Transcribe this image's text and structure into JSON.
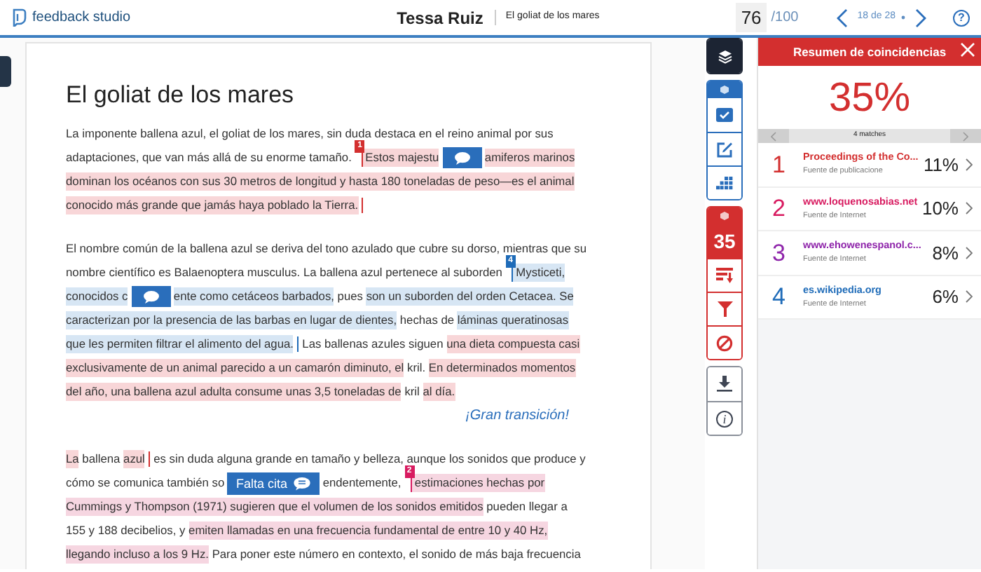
{
  "header": {
    "product": "feedback studio",
    "student": "Tessa Ruiz",
    "paper_title": "El goliat de los mares",
    "grade": "76",
    "grade_max": "/100",
    "pager": "18 de 28",
    "help_label": "?"
  },
  "document": {
    "title": "El goliat de los mares",
    "blocks": [
      {
        "kind": "paragraph",
        "lines": [
          {
            "parts": [
              {
                "kind": "text",
                "text": "La imponente ballena azul, el goliat de los mares, sin duda destaca en el reino animal por sus"
              }
            ]
          },
          {
            "parts": [
              {
                "kind": "text",
                "text": "adaptaciones, que van más allá de su enorme tamaño."
              },
              {
                "kind": "marker",
                "label": "1",
                "color": "#d32f2f"
              },
              {
                "kind": "text",
                "text": "Estos majestu",
                "color": "#f8d6d8"
              },
              {
                "kind": "bubble"
              },
              {
                "kind": "text",
                "text": "amiferos marinos",
                "color": "#f8d6d8"
              }
            ]
          },
          {
            "parts": [
              {
                "kind": "text",
                "text": "dominan los océanos con sus 30 metros de longitud y hasta 180 toneladas de peso—es el animal",
                "color": "#f8d6d8"
              }
            ]
          },
          {
            "parts": [
              {
                "kind": "text",
                "text": "conocido más grande que jamás haya poblado la Tierra.",
                "color": "#f8d6d8"
              },
              {
                "kind": "end",
                "color": "#d32f2f"
              }
            ]
          }
        ]
      },
      {
        "kind": "paragraph",
        "lines": [
          {
            "parts": [
              {
                "kind": "text",
                "text": "El nombre común de la ballena azul se deriva del tono azulado que cubre su dorso, mientras que su"
              }
            ]
          },
          {
            "parts": [
              {
                "kind": "text",
                "text": "nombre científico es Balaenoptera musculus. La ballena azul pertenece al suborden"
              },
              {
                "kind": "marker",
                "label": "4",
                "color": "#1e6bb8"
              },
              {
                "kind": "text",
                "text": "Mysticeti,",
                "color": "#d7e6f4"
              }
            ]
          },
          {
            "parts": [
              {
                "kind": "text",
                "text": "conocidos c",
                "color": "#d7e6f4"
              },
              {
                "kind": "bubble"
              },
              {
                "kind": "text",
                "text": "ente como cetáceos barbados,",
                "color": "#d7e6f4"
              },
              {
                "kind": "text",
                "text": "pues"
              },
              {
                "kind": "text",
                "text": "son un suborden del orden Cetacea. Se",
                "color": "#d7e6f4"
              }
            ]
          },
          {
            "parts": [
              {
                "kind": "text",
                "text": "caracterizan por la presencia de las barbas en lugar de dientes,",
                "color": "#d7e6f4"
              },
              {
                "kind": "text",
                "text": "hechas de"
              },
              {
                "kind": "text",
                "text": "láminas queratinosas",
                "color": "#d7e6f4"
              }
            ]
          },
          {
            "parts": [
              {
                "kind": "text",
                "text": "que les permiten filtrar el alimento del agua.",
                "color": "#d7e6f4"
              },
              {
                "kind": "end",
                "color": "#1e6bb8"
              },
              {
                "kind": "text",
                "text": "Las ballenas azules siguen"
              },
              {
                "kind": "text",
                "text": "una dieta compuesta casi",
                "color": "#f8d6d8"
              }
            ]
          },
          {
            "parts": [
              {
                "kind": "text",
                "text": "exclusivamente de un animal parecido a un camarón diminuto, el",
                "color": "#f8d6d8"
              },
              {
                "kind": "text",
                "text": "kril."
              },
              {
                "kind": "text",
                "text": "En determinados momentos",
                "color": "#f8d6d8"
              }
            ]
          },
          {
            "parts": [
              {
                "kind": "text",
                "text": "del año, una ballena azul adulta consume unas 3,5 toneladas de",
                "color": "#f8d6d8"
              },
              {
                "kind": "text",
                "text": "kril"
              },
              {
                "kind": "text",
                "text": "al día.",
                "color": "#f8d6d8"
              }
            ]
          }
        ]
      },
      {
        "kind": "comment",
        "text": "¡Gran transición!"
      },
      {
        "kind": "paragraph",
        "lines": [
          {
            "parts": [
              {
                "kind": "text",
                "text": "La",
                "color": "#f8d6d8"
              },
              {
                "kind": "text",
                "text": "ballena"
              },
              {
                "kind": "text",
                "text": "azul",
                "color": "#f8d6d8"
              },
              {
                "kind": "end",
                "color": "#d32f2f"
              },
              {
                "kind": "text",
                "text": "es sin duda alguna grande en tamaño y belleza, aunque los sonidos que produce y"
              }
            ]
          },
          {
            "parts": [
              {
                "kind": "text",
                "text": "cómo se comunica también so"
              },
              {
                "kind": "tag",
                "text": "Falta cita"
              },
              {
                "kind": "text",
                "text": "endentemente,"
              },
              {
                "kind": "marker",
                "label": "2",
                "color": "#d81b60"
              },
              {
                "kind": "text",
                "text": "estimaciones hechas por",
                "color": "#f6d6e1"
              }
            ]
          },
          {
            "parts": [
              {
                "kind": "text",
                "text": "Cummings y Thompson (1971) sugieren que el volumen de los sonidos emitidos",
                "color": "#f6d6e1"
              },
              {
                "kind": "text",
                "text": "pueden llegar a"
              }
            ]
          },
          {
            "parts": [
              {
                "kind": "text",
                "text": "155 y 188 decibelios, y"
              },
              {
                "kind": "text",
                "text": "emiten llamadas en una frecuencia fundamental de entre 10 y 40 Hz,",
                "color": "#f6d6e1"
              }
            ]
          },
          {
            "parts": [
              {
                "kind": "text",
                "text": "llegando incluso a los 9 Hz.",
                "color": "#f6d6e1"
              },
              {
                "kind": "text",
                "text": "Para poner este número en contexto, el sonido de más baja frecuencia"
              }
            ]
          }
        ]
      }
    ]
  },
  "toolbar": {
    "match_count": "35",
    "info_label": "i"
  },
  "match_panel": {
    "title": "Resumen de coincidencias",
    "score": "35%",
    "nav_label": "4 matches",
    "matches": [
      {
        "number": "1",
        "source": "Proceedings of the Co...",
        "type": "Fuente de publicacione",
        "percent": "11%",
        "color": "#d32f2f"
      },
      {
        "number": "2",
        "source": "www.loquenosabias.net",
        "type": "Fuente de Internet",
        "percent": "10%",
        "color": "#d81b60"
      },
      {
        "number": "3",
        "source": "www.ehowenespanol.c...",
        "type": "Fuente de Internet",
        "percent": "8%",
        "color": "#8e24aa"
      },
      {
        "number": "4",
        "source": "es.wikipedia.org",
        "type": "Fuente de Internet",
        "percent": "6%",
        "color": "#1e6bb8"
      }
    ]
  }
}
